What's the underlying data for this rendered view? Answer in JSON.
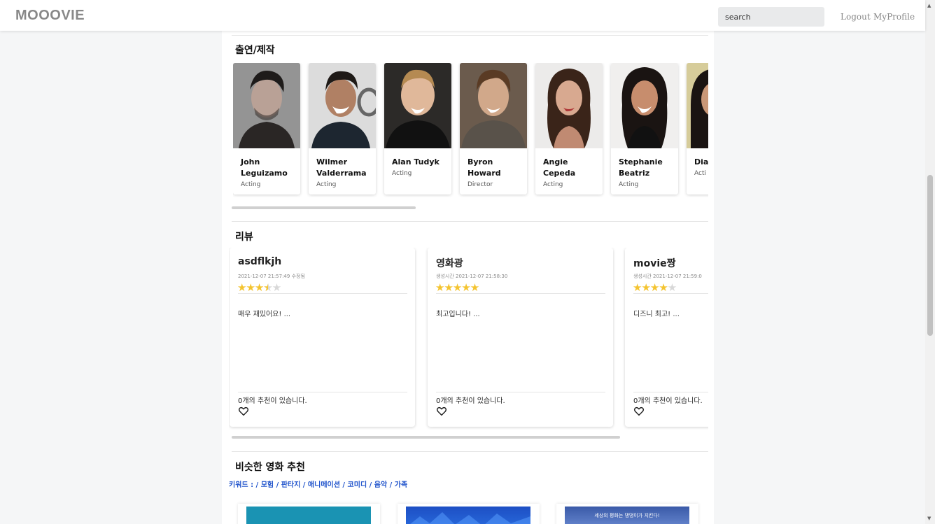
{
  "navbar": {
    "brand": "MOOOVIE",
    "search_value": "search",
    "logout_label": "Logout",
    "profile_label": "MyProfile"
  },
  "cast_section": {
    "title": "출연/제작",
    "members": [
      {
        "name": "John Leguizamo",
        "role": "Acting"
      },
      {
        "name": "Wilmer Valderrama",
        "role": "Acting"
      },
      {
        "name": "Alan Tudyk",
        "role": "Acting"
      },
      {
        "name": "Byron Howard",
        "role": "Director"
      },
      {
        "name": "Angie Cepeda",
        "role": "Acting"
      },
      {
        "name": "Stephanie Beatriz",
        "role": "Acting"
      },
      {
        "name": "Dia Gue",
        "role": "Acti"
      }
    ]
  },
  "review_section": {
    "title": "리뷰",
    "reviews": [
      {
        "user": "asdflkjh",
        "time": "2021-12-07 21:57:49 수정됨",
        "rating": 3.5,
        "body": "매우 재밌어요! ...",
        "recommendations": "0개의 추천이 있습니다."
      },
      {
        "user": "영화광",
        "time": "생성시간 2021-12-07 21:58:30",
        "rating": 5,
        "body": "최고입니다! ...",
        "recommendations": "0개의 추천이 있습니다."
      },
      {
        "user": "movie짱",
        "time": "생성시간 2021-12-07 21:59:0",
        "rating": 4,
        "body": "디즈니 최고! ...",
        "recommendations": "0개의 추천이 있습니다."
      }
    ]
  },
  "similar_section": {
    "title": "비슷한 영화 추천",
    "keywords": "키워드 : / 모험 / 판타지 / 애니메이션 / 코미디 / 음악 / 가족",
    "poster_caption": "세상의 평화는 댕댕이가 지킨다!"
  },
  "colors": {
    "star": "#f4c430",
    "keyword": "#2255cc",
    "brand": "#888888"
  }
}
